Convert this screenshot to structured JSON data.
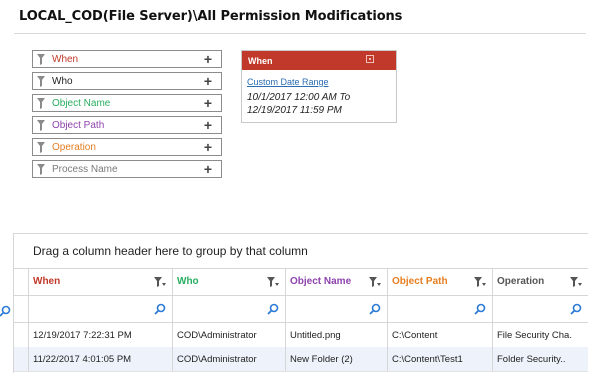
{
  "page": {
    "title": "LOCAL_COD(File Server)\\All Permission Modifications"
  },
  "filters": [
    {
      "label": "When",
      "color": "#c0392b"
    },
    {
      "label": "Who",
      "color": "#222222"
    },
    {
      "label": "Object Name",
      "color": "#27ae60"
    },
    {
      "label": "Object Path",
      "color": "#8e44ad"
    },
    {
      "label": "Operation",
      "color": "#e67e22"
    },
    {
      "label": "Process Name",
      "color": "#7a7a7a"
    }
  ],
  "when_panel": {
    "title": "When",
    "link": "Custom Date Range",
    "range_line1": "10/1/2017 12:00 AM To",
    "range_line2": "12/19/2017 11:59 PM"
  },
  "grid": {
    "group_hint": "Drag a column header here to group by that column",
    "columns": [
      {
        "label": "When",
        "color": "#c0392b"
      },
      {
        "label": "Who",
        "color": "#27ae60"
      },
      {
        "label": "Object Name",
        "color": "#8e44ad"
      },
      {
        "label": "Object Path",
        "color": "#e67e22"
      },
      {
        "label": "Operation",
        "color": "#555555"
      }
    ],
    "rows": [
      [
        "12/19/2017 7:22:31 PM",
        "COD\\Administrator",
        "Untitled.png",
        "C:\\Content",
        "File Security Cha."
      ],
      [
        "11/22/2017 4:01:05 PM",
        "COD\\Administrator",
        "New Folder (2)",
        "C:\\Content\\Test1",
        "Folder Security.."
      ]
    ]
  },
  "icons": {
    "filter": "funnel-icon",
    "add": "plus-icon",
    "search": "magnifier-icon",
    "close": "close-icon"
  }
}
